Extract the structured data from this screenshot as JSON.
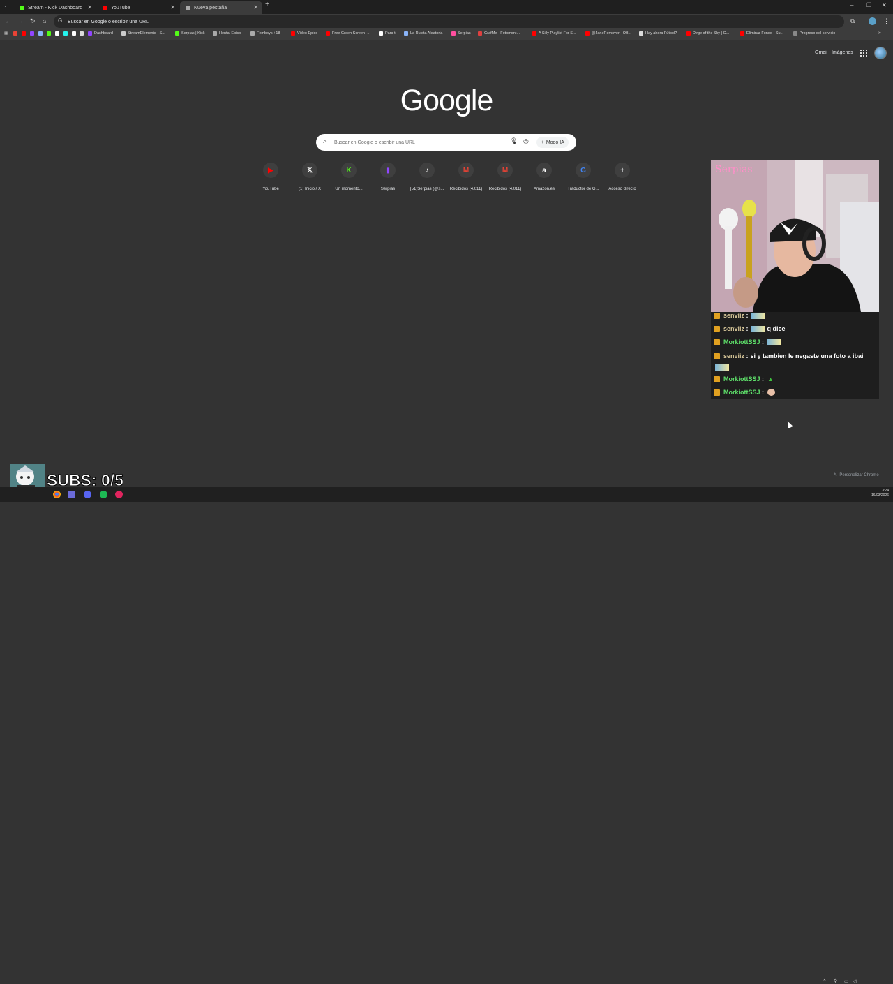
{
  "browser": {
    "tabs": [
      {
        "label": "Stream - Kick Dashboard",
        "color": "#53fc18"
      },
      {
        "label": "YouTube",
        "color": "#ff0000"
      },
      {
        "label": "Nueva pestaña",
        "color": "#aaaaaa"
      }
    ],
    "omnibox_text": "Buscar en Google o escribir una URL",
    "bookmarks": [
      {
        "label": "Dashboard",
        "color": "#9146ff"
      },
      {
        "label": "StreamElements - S...",
        "color": "#cccccc"
      },
      {
        "label": "Serpias | Kick",
        "color": "#53fc18"
      },
      {
        "label": "Hentai Epico",
        "color": "#aaaaaa"
      },
      {
        "label": "Femboys +18",
        "color": "#aaaaaa"
      },
      {
        "label": "Video Epico",
        "color": "#ff0000"
      },
      {
        "label": "Free Green Screen -...",
        "color": "#ff0000"
      },
      {
        "label": "Para ti",
        "color": "#ffffff"
      },
      {
        "label": "La Ruleta Aleatoria",
        "color": "#8ab4f8"
      },
      {
        "label": "Serpias",
        "color": "#ff4fa0"
      },
      {
        "label": "GrafMe - Fotomont...",
        "color": "#e04040"
      },
      {
        "label": "A Silly Playlist For S...",
        "color": "#ff0000"
      },
      {
        "label": "@JaneRemover - OB...",
        "color": "#ff0000"
      },
      {
        "label": "Hay ahora Fútbol?",
        "color": "#dddddd"
      },
      {
        "label": "Dirge of the Sky | C...",
        "color": "#ff0000"
      },
      {
        "label": "Eliminar Fondo - Su...",
        "color": "#ff0000"
      },
      {
        "label": "Progreso del servicio",
        "color": "#888888"
      }
    ]
  },
  "newtab": {
    "links": {
      "gmail": "Gmail",
      "images": "Imágenes"
    },
    "logo": "Google",
    "search_placeholder": "Buscar en Google o escribir una URL",
    "ai_mode": "Modo IA",
    "shortcuts": [
      {
        "label": "YouTube",
        "glyph": "▶",
        "color": "#ff0000"
      },
      {
        "label": "(1) Inicio / X",
        "glyph": "𝕏",
        "color": "#ffffff"
      },
      {
        "label": "Un momento...",
        "glyph": "K",
        "color": "#53fc18"
      },
      {
        "label": "Serpias",
        "glyph": "▮",
        "color": "#9146ff"
      },
      {
        "label": "(51)Serpias (@s...",
        "glyph": "♪",
        "color": "#ffffff"
      },
      {
        "label": "Recibidos (4.011)",
        "glyph": "M",
        "color": "#ea4335"
      },
      {
        "label": "Recibidos (4.011)",
        "glyph": "M",
        "color": "#ea4335"
      },
      {
        "label": "Amazon.es",
        "glyph": "a",
        "color": "#ffffff"
      },
      {
        "label": "Traductor de G...",
        "glyph": "G",
        "color": "#4285f4"
      },
      {
        "label": "Acceso directo",
        "glyph": "+",
        "color": "#e8eaed"
      }
    ],
    "customize": "Personalizar Chrome"
  },
  "stream_overlay": {
    "webcam_sign": "Serpias",
    "chat": [
      {
        "user": "senviiz",
        "text": "",
        "user_color": "tan",
        "emote": true
      },
      {
        "user": "senviiz",
        "text": "q dice",
        "user_color": "tan",
        "emote": true
      },
      {
        "user": "MorkiottSSJ",
        "text": "",
        "user_color": "green",
        "emote": true
      },
      {
        "user": "senviiz",
        "text": "si y tambien le negaste una foto a ibai",
        "user_color": "tan",
        "emote": true
      },
      {
        "user": "MorkiottSSJ",
        "text": "",
        "user_color": "green",
        "emote": false
      },
      {
        "user": "MorkiottSSJ",
        "text": "",
        "user_color": "green",
        "emote": false
      }
    ],
    "subs": "SUBS: 0/5"
  },
  "taskbar": {
    "time": "3:24",
    "date": "16/03/2026"
  }
}
